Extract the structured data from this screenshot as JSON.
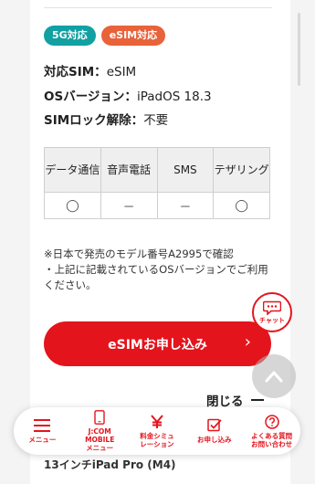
{
  "badges": {
    "fiveg": "5G対応",
    "esim": "eSIM対応"
  },
  "specs": {
    "sim_key": "対応SIM：",
    "sim_val": "eSIM",
    "os_key": "OSバージョン：",
    "os_val": "iPadOS 18.3",
    "lock_key": "SIMロック解除：",
    "lock_val": "不要"
  },
  "compat_table": {
    "headers": [
      "データ通信",
      "音声電話",
      "SMS",
      "テザリング"
    ],
    "values": [
      "◯",
      "－",
      "－",
      "◯"
    ]
  },
  "note": {
    "line1": "※日本で発売のモデル番号A2995で確認",
    "line2": "・上記に記載されているOSバージョンでご利用",
    "line3": "ください。"
  },
  "apply_button": {
    "label": "eSIMお申し込み",
    "chevron": "›"
  },
  "chat": {
    "label": "チャット"
  },
  "close": {
    "label": "閉じる"
  },
  "behind": {
    "text": "13インチiPad Pro (M4)"
  },
  "nav": {
    "items": [
      {
        "label": "メニュー",
        "icon": "menu-icon"
      },
      {
        "label": "J:COM MOBILE\nメニュー",
        "icon": "phone-icon"
      },
      {
        "label": "料金シミュ\nレーション",
        "icon": "yen-icon"
      },
      {
        "label": "お申し込み",
        "icon": "checkbox-icon"
      },
      {
        "label": "よくある質問\nお問い合わせ",
        "icon": "help-icon"
      }
    ]
  },
  "colors": {
    "brand_red": "#e4141c",
    "teal": "#12a0a2",
    "orange": "#e8623a"
  }
}
